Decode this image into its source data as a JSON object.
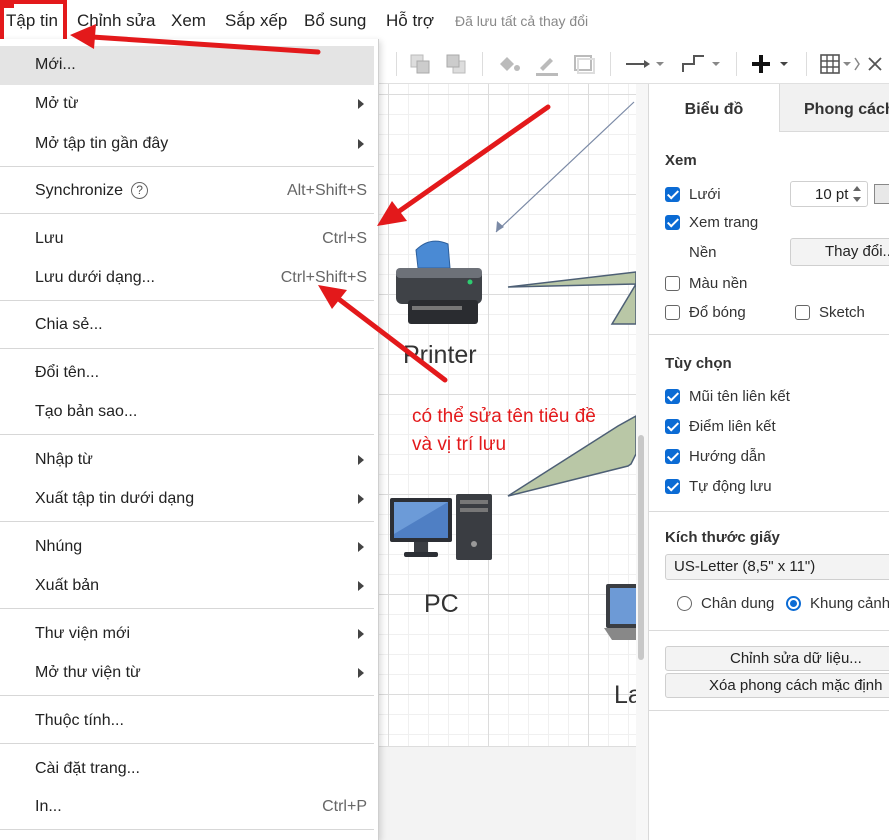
{
  "menubar": {
    "items": [
      "Tập tin",
      "Chỉnh sửa",
      "Xem",
      "Sắp xếp",
      "Bổ sung",
      "Hỗ trợ"
    ],
    "status": "Đã lưu tất cả thay đổi"
  },
  "file_menu": {
    "new": "Mới...",
    "open_from": "Mở từ",
    "open_recent": "Mở tập tin gần đây",
    "synchronize": "Synchronize",
    "synchronize_help": "?",
    "synchronize_shortcut": "Alt+Shift+S",
    "save": "Lưu",
    "save_shortcut": "Ctrl+S",
    "save_as": "Lưu dưới dạng...",
    "save_as_shortcut": "Ctrl+Shift+S",
    "share": "Chia sẻ...",
    "rename": "Đổi tên...",
    "make_copy": "Tạo bản sao...",
    "import_from": "Nhập từ",
    "export_as": "Xuất tập tin dưới dạng",
    "embed": "Nhúng",
    "publish": "Xuất bản",
    "new_library": "Thư viện mới",
    "open_library_from": "Mở thư viện từ",
    "properties": "Thuộc tính...",
    "page_setup": "Cài đặt trang...",
    "print": "In...",
    "print_shortcut": "Ctrl+P"
  },
  "canvas": {
    "printer_label": "Printer",
    "pc_label": "PC",
    "laptop_label": "La",
    "annotation_line1": "có thể sửa tên tiêu đề",
    "annotation_line2": "và vị trí lưu"
  },
  "panel": {
    "tab_diagram": "Biểu đồ",
    "tab_style": "Phong cách",
    "view_section": "Xem",
    "grid_label": "Lưới",
    "grid_size": "10 pt",
    "page_view_label": "Xem trang",
    "background_label": "Nền",
    "change_button": "Thay đổi...",
    "background_color_label": "Màu nền",
    "shadow_label": "Đổ bóng",
    "sketch_label": "Sketch",
    "options_section": "Tùy chọn",
    "connection_arrows": "Mũi tên liên kết",
    "connection_points": "Điểm liên kết",
    "guides": "Hướng dẫn",
    "autosave": "Tự động lưu",
    "paper_size_section": "Kích thước giấy",
    "paper_size_value": "US-Letter (8,5\" x 11\")",
    "portrait": "Chân dung",
    "landscape": "Khung cảnh",
    "edit_data_button": "Chỉnh sửa dữ liệu...",
    "clear_style_button": "Xóa phong cách mặc định"
  },
  "colors": {
    "annotation_red": "#e3191b",
    "checkbox_blue": "#0b6bd4",
    "shape_fill": "#b9c7a6"
  },
  "icons": [
    "plus-icon",
    "grid-icon",
    "arrow-icon",
    "waypoint-icon",
    "fill-color-icon",
    "line-color-icon",
    "shadow-icon",
    "chevron-right-icon",
    "help-icon",
    "printer-icon",
    "pc-icon",
    "laptop-icon"
  ]
}
